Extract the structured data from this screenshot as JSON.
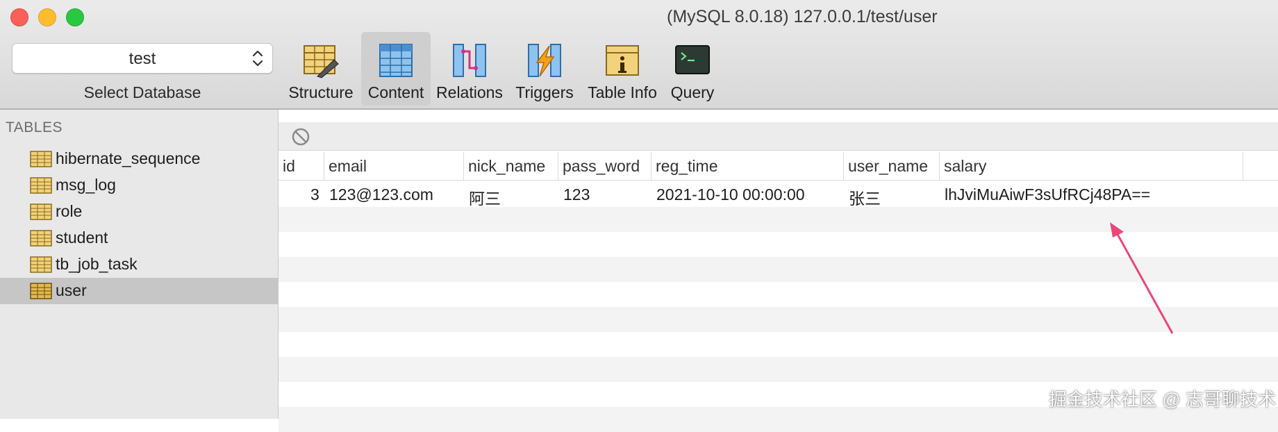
{
  "window": {
    "title": "(MySQL 8.0.18) 127.0.0.1/test/user"
  },
  "database_selector": {
    "value": "test",
    "caption": "Select Database"
  },
  "toolbar": [
    {
      "label": "Structure",
      "icon": "structure-icon"
    },
    {
      "label": "Content",
      "icon": "content-icon",
      "active": true
    },
    {
      "label": "Relations",
      "icon": "relations-icon"
    },
    {
      "label": "Triggers",
      "icon": "triggers-icon"
    },
    {
      "label": "Table Info",
      "icon": "table-info-icon"
    },
    {
      "label": "Query",
      "icon": "query-icon"
    }
  ],
  "sidebar": {
    "heading": "TABLES",
    "items": [
      {
        "label": "hibernate_sequence"
      },
      {
        "label": "msg_log"
      },
      {
        "label": "role"
      },
      {
        "label": "student"
      },
      {
        "label": "tb_job_task"
      },
      {
        "label": "user",
        "selected": true
      }
    ]
  },
  "grid": {
    "columns": [
      "id",
      "email",
      "nick_name",
      "pass_word",
      "reg_time",
      "user_name",
      "salary"
    ],
    "rows": [
      [
        "3",
        "123@123.com",
        "阿三",
        "123",
        "2021-10-10 00:00:00",
        "张三",
        "lhJviMuAiwF3sUfRCj48PA=="
      ]
    ]
  },
  "watermark": "掘金技术社区 @ 志哥聊技术",
  "colors": {
    "accent_arrow": "#e8477a",
    "selected_row": "#c6c6c6"
  }
}
